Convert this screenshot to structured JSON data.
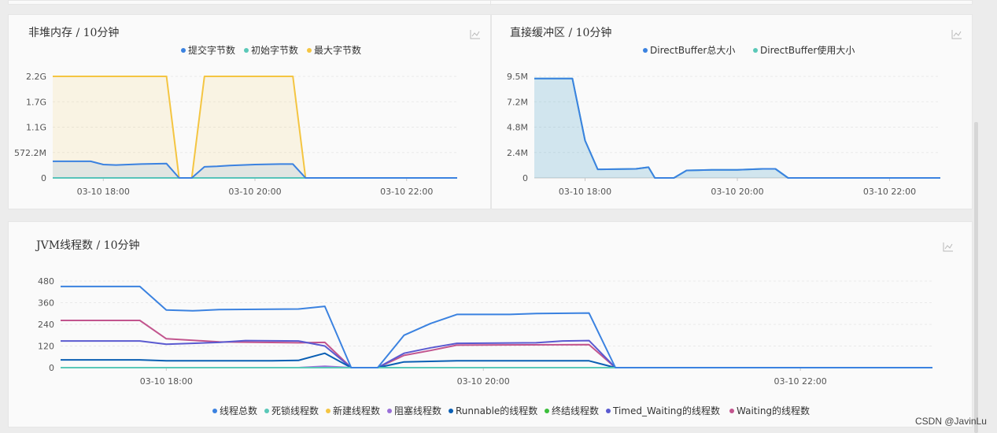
{
  "watermark": "CSDN @JavinLu",
  "charts": [
    {
      "id": "nonheap",
      "title": "非堆内存 / 10分钟",
      "type": "area",
      "legend": [
        "提交字节数",
        "初始字节数",
        "最大字节数"
      ],
      "colors": [
        "#3b82e0",
        "#5ac8b8",
        "#f4c542"
      ],
      "yticks": [
        "0",
        "572.2M",
        "1.1G",
        "1.7G",
        "2.2G"
      ],
      "ylim": [
        0,
        2.2
      ],
      "yunit": "G",
      "xlim": [
        "17:20",
        "22:40"
      ],
      "xticks": [
        "03-10 18:00",
        "03-10 20:00",
        "03-10 22:00"
      ],
      "xtick_times": [
        "18:00",
        "20:00",
        "22:00"
      ],
      "series": [
        {
          "name": "提交字节数",
          "points": [
            [
              "17:20",
              0.36
            ],
            [
              "17:50",
              0.36
            ],
            [
              "18:00",
              0.29
            ],
            [
              "18:10",
              0.28
            ],
            [
              "18:30",
              0.3
            ],
            [
              "18:50",
              0.31
            ],
            [
              "19:00",
              0.0
            ],
            [
              "19:10",
              0.0
            ],
            [
              "19:20",
              0.24
            ],
            [
              "19:30",
              0.25
            ],
            [
              "19:40",
              0.27
            ],
            [
              "20:00",
              0.29
            ],
            [
              "20:20",
              0.3
            ],
            [
              "20:30",
              0.3
            ],
            [
              "20:40",
              0.0
            ],
            [
              "22:40",
              0.0
            ]
          ]
        },
        {
          "name": "初始字节数",
          "points": [
            [
              "17:20",
              0.0
            ],
            [
              "22:40",
              0.0
            ]
          ]
        },
        {
          "name": "最大字节数",
          "points": [
            [
              "17:20",
              2.2
            ],
            [
              "18:50",
              2.2
            ],
            [
              "19:00",
              0.0
            ],
            [
              "19:10",
              0.0
            ],
            [
              "19:20",
              2.2
            ],
            [
              "20:30",
              2.2
            ],
            [
              "20:40",
              0.0
            ],
            [
              "22:40",
              0.0
            ]
          ]
        }
      ]
    },
    {
      "id": "directbuffer",
      "title": "直接缓冲区 / 10分钟",
      "type": "area",
      "legend": [
        "DirectBuffer总大小",
        "DirectBuffer使用大小"
      ],
      "colors": [
        "#3b82e0",
        "#5ac8b8"
      ],
      "yticks": [
        "0",
        "2.4M",
        "4.8M",
        "7.2M",
        "9.5M"
      ],
      "ylim": [
        0,
        9.5
      ],
      "yunit": "M",
      "xlim": [
        "17:20",
        "22:40"
      ],
      "xticks": [
        "03-10 18:00",
        "03-10 20:00",
        "03-10 22:00"
      ],
      "xtick_times": [
        "18:00",
        "20:00",
        "22:00"
      ],
      "series": [
        {
          "name": "DirectBuffer总大小",
          "points": [
            [
              "17:20",
              9.3
            ],
            [
              "17:50",
              9.3
            ],
            [
              "18:00",
              3.5
            ],
            [
              "18:10",
              0.8
            ],
            [
              "18:40",
              0.85
            ],
            [
              "18:50",
              1.0
            ],
            [
              "18:55",
              0.0
            ],
            [
              "19:10",
              0.0
            ],
            [
              "19:20",
              0.7
            ],
            [
              "19:40",
              0.75
            ],
            [
              "20:00",
              0.75
            ],
            [
              "20:20",
              0.85
            ],
            [
              "20:30",
              0.85
            ],
            [
              "20:40",
              0.0
            ],
            [
              "22:40",
              0.0
            ]
          ]
        },
        {
          "name": "DirectBuffer使用大小",
          "points": [
            [
              "17:20",
              9.3
            ],
            [
              "17:50",
              9.3
            ],
            [
              "18:00",
              3.5
            ],
            [
              "18:10",
              0.8
            ],
            [
              "18:40",
              0.85
            ],
            [
              "18:50",
              1.0
            ],
            [
              "18:55",
              0.0
            ],
            [
              "19:10",
              0.0
            ],
            [
              "19:20",
              0.7
            ],
            [
              "19:40",
              0.75
            ],
            [
              "20:00",
              0.75
            ],
            [
              "20:20",
              0.85
            ],
            [
              "20:30",
              0.85
            ],
            [
              "20:40",
              0.0
            ],
            [
              "22:40",
              0.0
            ]
          ]
        }
      ]
    },
    {
      "id": "jvmthreads",
      "title": "JVM线程数 / 10分钟",
      "type": "line",
      "legend": [
        "线程总数",
        "死锁线程数",
        "新建线程数",
        "阻塞线程数",
        "Runnable的线程数",
        "终结线程数",
        "Timed_Waiting的线程数",
        "Waiting的线程数"
      ],
      "colors": [
        "#3b82e0",
        "#5ac8b8",
        "#f4c542",
        "#9a70d8",
        "#0a5fb4",
        "#3cbf3c",
        "#5a5ad0",
        "#c2558e"
      ],
      "yticks": [
        "0",
        "120",
        "240",
        "360",
        "480"
      ],
      "ylim": [
        0,
        480
      ],
      "xlim": [
        "17:20",
        "22:50"
      ],
      "xticks": [
        "03-10 18:00",
        "03-10 20:00",
        "03-10 22:00"
      ],
      "xtick_times": [
        "18:00",
        "20:00",
        "22:00"
      ],
      "series": [
        {
          "name": "线程总数",
          "points": [
            [
              "17:20",
              450
            ],
            [
              "17:50",
              450
            ],
            [
              "18:00",
              320
            ],
            [
              "18:10",
              315
            ],
            [
              "18:20",
              322
            ],
            [
              "18:50",
              325
            ],
            [
              "19:00",
              340
            ],
            [
              "19:10",
              0
            ],
            [
              "19:20",
              0
            ],
            [
              "19:30",
              180
            ],
            [
              "19:40",
              245
            ],
            [
              "19:50",
              295
            ],
            [
              "20:10",
              295
            ],
            [
              "20:20",
              300
            ],
            [
              "20:40",
              303
            ],
            [
              "20:50",
              0
            ],
            [
              "22:50",
              0
            ]
          ]
        },
        {
          "name": "死锁线程数",
          "points": [
            [
              "17:20",
              0
            ],
            [
              "22:50",
              0
            ]
          ]
        },
        {
          "name": "新建线程数",
          "points": [
            [
              "17:20",
              0
            ],
            [
              "22:50",
              0
            ]
          ]
        },
        {
          "name": "阻塞线程数",
          "points": [
            [
              "17:20",
              0
            ],
            [
              "18:50",
              0
            ],
            [
              "19:00",
              8
            ],
            [
              "19:10",
              0
            ],
            [
              "22:50",
              0
            ]
          ]
        },
        {
          "name": "Runnable的线程数",
          "points": [
            [
              "17:20",
              43
            ],
            [
              "17:50",
              43
            ],
            [
              "18:00",
              38
            ],
            [
              "18:40",
              38
            ],
            [
              "18:50",
              40
            ],
            [
              "19:00",
              80
            ],
            [
              "19:10",
              0
            ],
            [
              "19:20",
              0
            ],
            [
              "19:30",
              32
            ],
            [
              "19:50",
              38
            ],
            [
              "20:40",
              38
            ],
            [
              "20:50",
              0
            ],
            [
              "22:50",
              0
            ]
          ]
        },
        {
          "name": "终结线程数",
          "points": [
            [
              "17:20",
              0
            ],
            [
              "22:50",
              0
            ]
          ]
        },
        {
          "name": "Timed_Waiting的线程数",
          "points": [
            [
              "17:20",
              148
            ],
            [
              "17:50",
              148
            ],
            [
              "18:00",
              130
            ],
            [
              "18:20",
              140
            ],
            [
              "18:30",
              150
            ],
            [
              "18:50",
              148
            ],
            [
              "19:00",
              120
            ],
            [
              "19:10",
              0
            ],
            [
              "19:20",
              0
            ],
            [
              "19:30",
              80
            ],
            [
              "19:40",
              110
            ],
            [
              "19:50",
              135
            ],
            [
              "20:20",
              138
            ],
            [
              "20:30",
              148
            ],
            [
              "20:40",
              150
            ],
            [
              "20:50",
              0
            ],
            [
              "22:50",
              0
            ]
          ]
        },
        {
          "name": "Waiting的线程数",
          "points": [
            [
              "17:20",
              262
            ],
            [
              "17:50",
              262
            ],
            [
              "18:00",
              160
            ],
            [
              "18:20",
              143
            ],
            [
              "18:50",
              138
            ],
            [
              "19:00",
              140
            ],
            [
              "19:10",
              0
            ],
            [
              "19:20",
              0
            ],
            [
              "19:30",
              68
            ],
            [
              "19:40",
              95
            ],
            [
              "19:50",
              125
            ],
            [
              "20:40",
              128
            ],
            [
              "20:50",
              0
            ],
            [
              "22:50",
              0
            ]
          ]
        }
      ]
    }
  ]
}
